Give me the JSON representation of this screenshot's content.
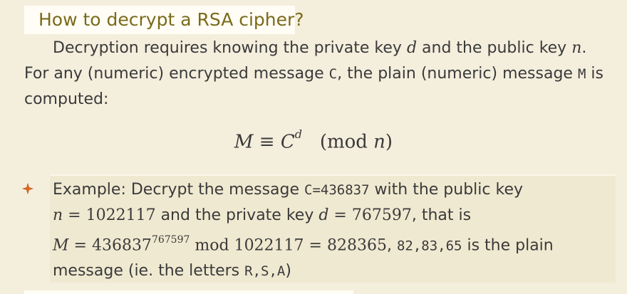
{
  "heading": "How to decrypt a RSA cipher?",
  "intro": {
    "t1": "Decryption requires knowing the private key ",
    "d": "d",
    "t2": " and the public key ",
    "n": "n",
    "t3": ".",
    "t4": "For any (numeric) encrypted message ",
    "C": "C",
    "t5": ", the plain (numeric) message ",
    "M": "M",
    "t6": " is computed:"
  },
  "formula": {
    "lhs": "M",
    "equiv": "≡",
    "base": "C",
    "exp": "d",
    "mod": "(mod ",
    "n": "n",
    "close": ")"
  },
  "example": {
    "t1": "Example: Decrypt the message ",
    "code1": "C=436837",
    "t2": " with the public key",
    "n": "n",
    "eq1": " = 1022117",
    "t3": " and the private key ",
    "d": "d",
    "eq2": " = 767597",
    "t4": ", that is",
    "M": "M",
    "eq3": " = 436837",
    "exp": "767597",
    "eq4": " mod 1022117 = 828365",
    "t5": ", ",
    "code2": "82,83,65",
    "t6": " is the plain",
    "t7": "message (ie. the letters ",
    "code3": "R,S,A",
    "t8": ")"
  },
  "colors": {
    "heading": "#7a6a1a",
    "background": "#f4eedd",
    "example_bg": "#f0e9d1",
    "star": "#e06a1a"
  }
}
